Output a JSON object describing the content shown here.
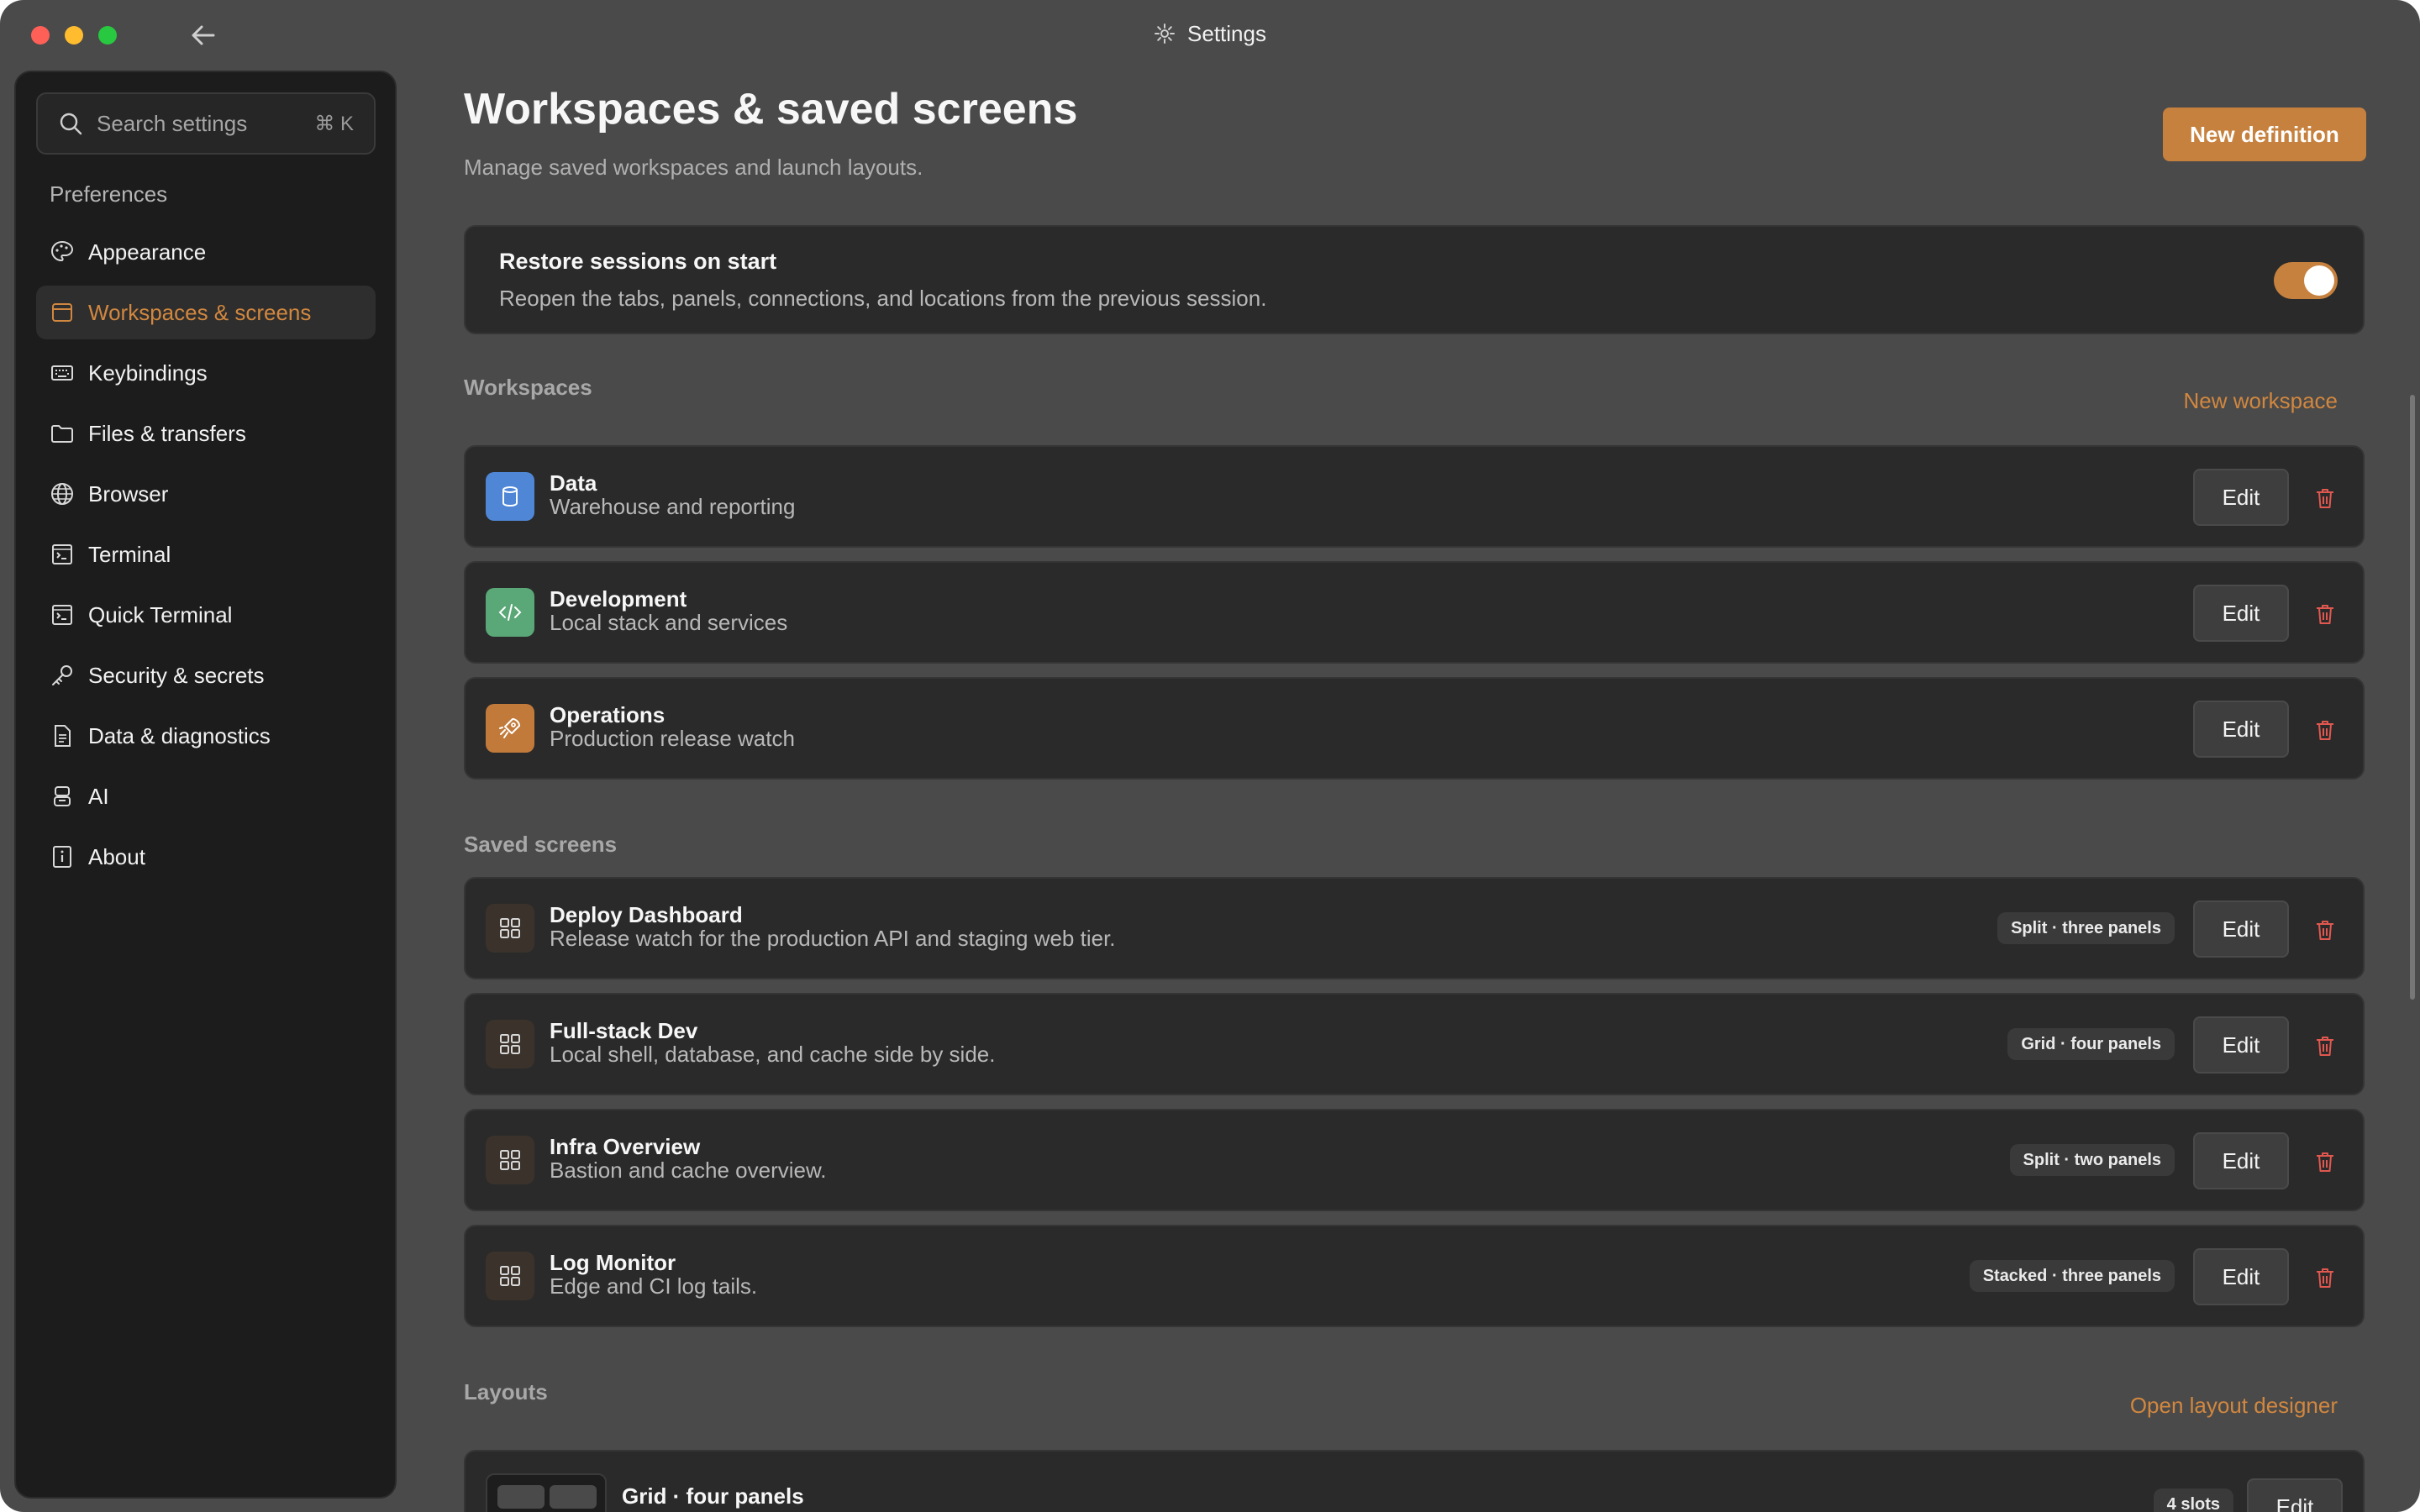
{
  "window": {
    "title": "Settings"
  },
  "sidebar": {
    "search_placeholder": "Search settings",
    "search_shortcut": "⌘ K",
    "heading": "Preferences",
    "items": [
      {
        "label": "Appearance",
        "icon": "palette-icon",
        "active": false
      },
      {
        "label": "Workspaces & screens",
        "icon": "window-icon",
        "active": true
      },
      {
        "label": "Keybindings",
        "icon": "keyboard-icon",
        "active": false
      },
      {
        "label": "Files & transfers",
        "icon": "folder-icon",
        "active": false
      },
      {
        "label": "Browser",
        "icon": "globe-icon",
        "active": false
      },
      {
        "label": "Terminal",
        "icon": "terminal-icon",
        "active": false
      },
      {
        "label": "Quick Terminal",
        "icon": "terminal-icon",
        "active": false
      },
      {
        "label": "Security & secrets",
        "icon": "key-icon",
        "active": false
      },
      {
        "label": "Data & diagnostics",
        "icon": "document-icon",
        "active": false
      },
      {
        "label": "AI",
        "icon": "robot-icon",
        "active": false
      },
      {
        "label": "About",
        "icon": "info-icon",
        "active": false
      }
    ]
  },
  "header": {
    "title": "Workspaces & saved screens",
    "subtitle": "Manage saved workspaces and launch layouts.",
    "new_definition_label": "New definition"
  },
  "restore": {
    "title": "Restore sessions on start",
    "description": "Reopen the tabs, panels, connections, and locations from the previous session.",
    "enabled": true
  },
  "workspaces": {
    "heading": "Workspaces",
    "new_label": "New workspace",
    "items": [
      {
        "name": "Data",
        "description": "Warehouse and reporting",
        "icon": "database-icon",
        "color": "#4f87d6",
        "edit_label": "Edit"
      },
      {
        "name": "Development",
        "description": "Local stack and services",
        "icon": "code-icon",
        "color": "#5aa777",
        "edit_label": "Edit"
      },
      {
        "name": "Operations",
        "description": "Production release watch",
        "icon": "rocket-icon",
        "color": "#c27a3a",
        "edit_label": "Edit"
      }
    ]
  },
  "saved_screens": {
    "heading": "Saved screens",
    "items": [
      {
        "name": "Deploy Dashboard",
        "description": "Release watch for the production API and staging web tier.",
        "badge": "Split · three panels",
        "edit_label": "Edit"
      },
      {
        "name": "Full-stack Dev",
        "description": "Local shell, database, and cache side by side.",
        "badge": "Grid · four panels",
        "edit_label": "Edit"
      },
      {
        "name": "Infra Overview",
        "description": "Bastion and cache overview.",
        "badge": "Split · two panels",
        "edit_label": "Edit"
      },
      {
        "name": "Log Monitor",
        "description": "Edge and CI log tails.",
        "badge": "Stacked · three panels",
        "edit_label": "Edit"
      }
    ]
  },
  "layouts": {
    "heading": "Layouts",
    "designer_label": "Open layout designer",
    "items": [
      {
        "name": "Grid · four panels",
        "badge": "4 slots",
        "edit_label": "Edit"
      }
    ]
  },
  "colors": {
    "accent": "#c7813e",
    "background": "#4a4a4a",
    "card": "#2a2a2a",
    "danger": "#e0584f"
  }
}
